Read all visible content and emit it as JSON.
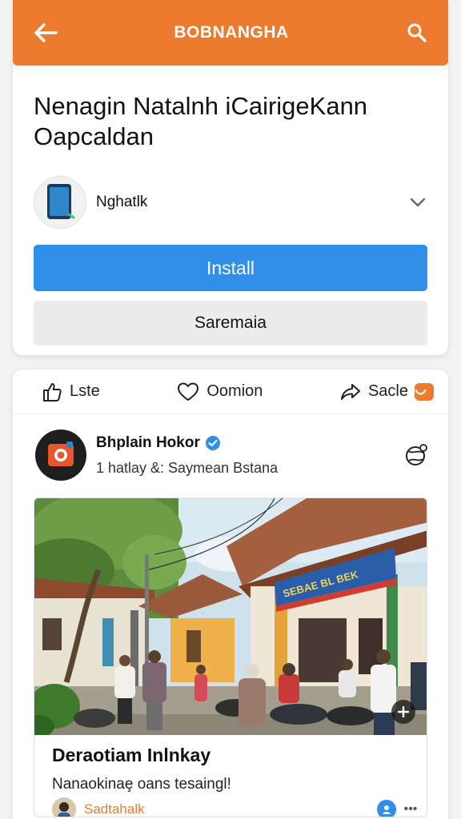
{
  "app_bar": {
    "title": "BOBNANGHA",
    "back_icon": "arrow-left-icon",
    "search_icon": "search-icon",
    "color": "#ec7a2f"
  },
  "promo": {
    "headline_line1": "Nenagin Natalnh iCairigeKann",
    "headline_line2": "Oapcaldan",
    "app_name": "Nghatlk",
    "install_label": "Install",
    "secondary_label": "Saremaia",
    "install_color": "#2f8fe6"
  },
  "actions": {
    "like_label": "Lste",
    "comment_label": "Oomion",
    "share_label": "Sacle"
  },
  "post": {
    "author_name": "Bhplain Hokor",
    "author_meta": "1 hatlay &: Saymean Bstana",
    "photo_banner": "SEBAE BL BEK",
    "title": "Deraotiam Inlnkay",
    "description": "Nanaokinaȩ oans tesaingl!",
    "source_name": "Sadtahalk",
    "source_more": "•••"
  }
}
